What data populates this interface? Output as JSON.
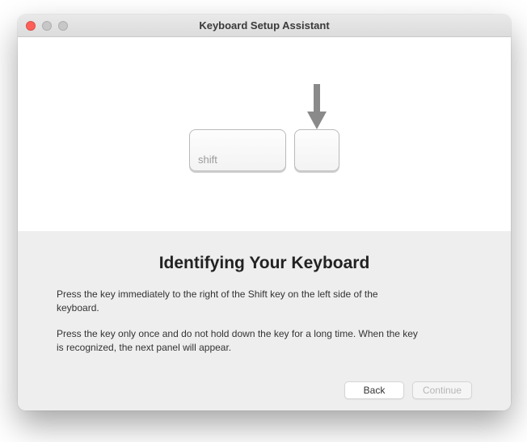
{
  "window": {
    "title": "Keyboard Setup Assistant"
  },
  "illustration": {
    "shift_key_label": "shift"
  },
  "content": {
    "heading": "Identifying Your Keyboard",
    "paragraph1": "Press the key immediately to the right of the Shift key on the left side of the keyboard.",
    "paragraph2": "Press the key only once and do not hold down the key for a long time. When the key is recognized, the next panel will appear."
  },
  "buttons": {
    "back": "Back",
    "continue": "Continue"
  }
}
